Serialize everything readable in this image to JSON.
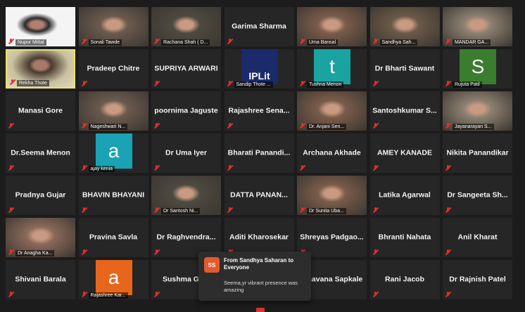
{
  "participants": [
    {
      "name": "Nupur Mittal",
      "video": true
    },
    {
      "name": "Sonali Tawde",
      "video": true
    },
    {
      "name": "Rachana Shah ( D...",
      "video": true
    },
    {
      "name": "Garima Sharma",
      "video": false
    },
    {
      "name": "Uma Bansal",
      "video": true
    },
    {
      "name": "Sandhya Sah...",
      "video": true
    },
    {
      "name": "MANDAR GA...",
      "video": true
    },
    {
      "name": "Rekha Thote",
      "video": true,
      "active": true
    },
    {
      "name": "Pradeep Chitre",
      "video": false
    },
    {
      "name": "SUPRIYA ARWARI",
      "video": false
    },
    {
      "name": "Sandip Thote ...",
      "video": true,
      "logo_text": "IPLit"
    },
    {
      "name": "Tushna Menon",
      "video": true,
      "letter": "t",
      "letter_bg": "#1aa3a0"
    },
    {
      "name": "Dr Bharti Sawant",
      "video": false
    },
    {
      "name": "Rujuta Patil",
      "video": true,
      "letter": "S",
      "letter_bg": "#3a7d2e"
    },
    {
      "name": "Manasi Gore",
      "video": false
    },
    {
      "name": "Nageshwari N...",
      "video": true
    },
    {
      "name": "poornima Jaguste",
      "video": false
    },
    {
      "name": "Rajashree Sena...",
      "video": false
    },
    {
      "name": "Dr. Anjani Sen...",
      "video": true
    },
    {
      "name": "Santoshkumar S...",
      "video": false
    },
    {
      "name": "Jayanarayan S...",
      "video": true
    },
    {
      "name": "Dr.Seema Menon",
      "video": false
    },
    {
      "name": "ajay kenia",
      "video": true,
      "letter": "a",
      "letter_bg": "#1aa3b5"
    },
    {
      "name": "Dr Uma Iyer",
      "video": false
    },
    {
      "name": "Bharati Panandi...",
      "video": false
    },
    {
      "name": "Archana Akhade",
      "video": false
    },
    {
      "name": "AMEY KANADE",
      "video": false
    },
    {
      "name": "Nikita Panandikar",
      "video": false
    },
    {
      "name": "Pradnya Gujar",
      "video": false
    },
    {
      "name": "BHAVIN BHAYANI",
      "video": false
    },
    {
      "name": "Dr Santosh Ni...",
      "video": true
    },
    {
      "name": "DATTA PANAN...",
      "video": false
    },
    {
      "name": "Dr Sunita Uba...",
      "video": true
    },
    {
      "name": "Latika Agarwal",
      "video": false
    },
    {
      "name": "Dr Sangeeta Sh...",
      "video": false
    },
    {
      "name": "Dr Anagha Ka...",
      "video": true
    },
    {
      "name": "Pravina Savla",
      "video": false
    },
    {
      "name": "Dr Raghvendra...",
      "video": false
    },
    {
      "name": "Aditi Kharosekar",
      "video": false
    },
    {
      "name": "Shreyas Padgao...",
      "video": false
    },
    {
      "name": "Bhranti Nahata",
      "video": false
    },
    {
      "name": "Anil Kharat",
      "video": false
    },
    {
      "name": "Shivani Barala",
      "video": false
    },
    {
      "name": "Rajashree Kar...",
      "video": true,
      "letter": "a",
      "letter_bg": "#e8661c"
    },
    {
      "name": "Sushma Gu...",
      "video": false
    },
    {
      "name": "",
      "video": false
    },
    {
      "name": "...havana Sapkale",
      "video": false
    },
    {
      "name": "Rani Jacob",
      "video": false
    },
    {
      "name": "Dr Rajnish Patel",
      "video": false
    }
  ],
  "chat_popup": {
    "avatar": "SS",
    "from": "From Sandhya Saharan to Everyone",
    "message": "Seema,yr vibrant presence was amazing"
  }
}
